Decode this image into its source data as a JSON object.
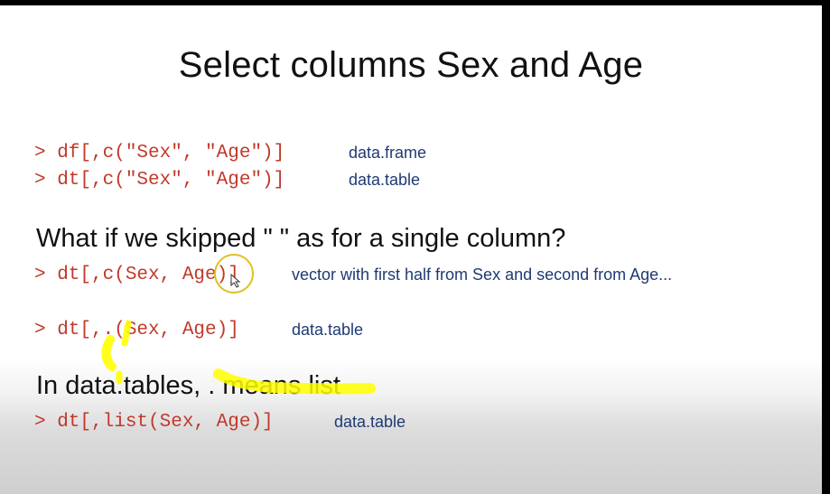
{
  "slide": {
    "title": "Select columns Sex and Age",
    "lines": [
      {
        "code": "> df[,c(\"Sex\", \"Age\")]",
        "note": "data.frame"
      },
      {
        "code": "> dt[,c(\"Sex\", \"Age\")]",
        "note": "data.table"
      }
    ],
    "question": "What if we skipped \" \" as for a single column?",
    "lines2": [
      {
        "code": "> dt[,c(Sex, Age)]",
        "note": "vector with first half from Sex and second from Age..."
      },
      {
        "code": "> dt[,.(Sex, Age)]",
        "note": "data.table"
      }
    ],
    "statement": "In data.tables, . means list",
    "lines3": [
      {
        "code": "> dt[,list(Sex, Age)]",
        "note": "data.table"
      }
    ]
  },
  "annotation": {
    "highlight_color": "#ffff00",
    "cursor_ring_color": "#e0c020"
  }
}
